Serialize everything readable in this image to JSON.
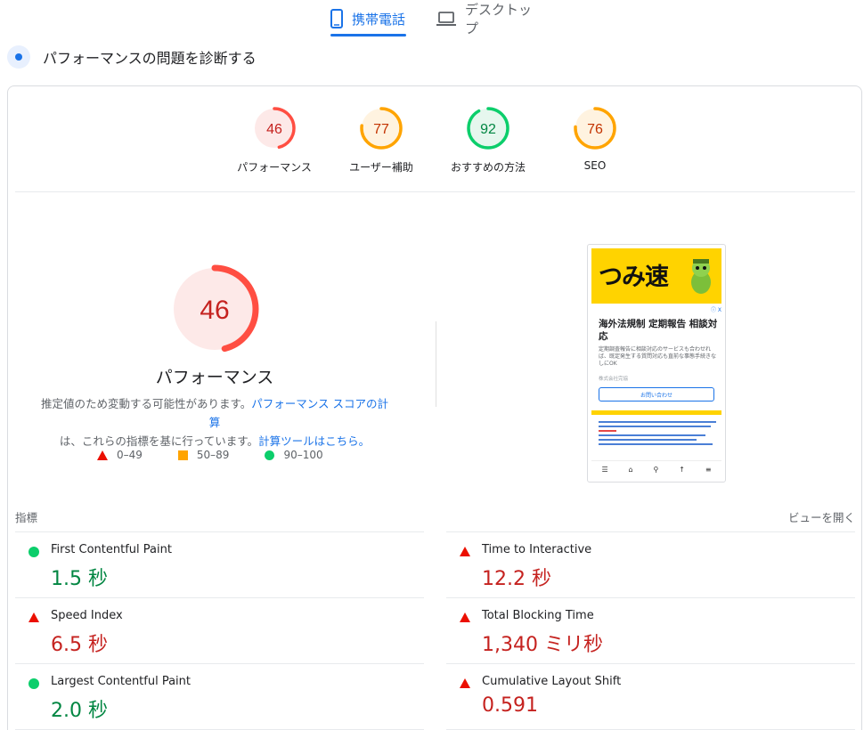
{
  "tabs": {
    "mobile_label": "携帯電話",
    "desktop_label": "デスクトップ"
  },
  "diagnose": {
    "title": "パフォーマンスの問題を診断する"
  },
  "colors": {
    "fail": "#ff4e42",
    "average": "#ffa400",
    "pass": "#0cce6b",
    "accent": "#1a73e8"
  },
  "scores": [
    {
      "label": "パフォーマンス",
      "value": 46,
      "level": "fail"
    },
    {
      "label": "ユーザー補助",
      "value": 77,
      "level": "average"
    },
    {
      "label": "おすすめの方法",
      "value": 92,
      "level": "pass"
    },
    {
      "label": "SEO",
      "value": 76,
      "level": "average"
    }
  ],
  "performance": {
    "score": "46",
    "title": "パフォーマンス",
    "desc_part1": "推定値のため変動する可能性があります。",
    "desc_link1": "パフォーマンス スコアの計算",
    "desc_part2": "は、これらの指標を基に行っています。",
    "desc_link2": "計算ツールはこちら。"
  },
  "legend": {
    "fail": "0–49",
    "average": "50–89",
    "pass": "90–100"
  },
  "screenshot": {
    "logo": "つみ速",
    "ad_tag": "ⓘ X",
    "ad_title": "海外法規制 定期報告 相談対応",
    "ad_text": "定期調査報告に相談対応のサービスも合わせれば、既定発生する質問対応も直前な事態手続きなしにOK",
    "company": "株式会社完協",
    "button": "お問い合わせ"
  },
  "metrics_header": {
    "left": "指標",
    "right": "ビューを開く"
  },
  "metrics": {
    "fcp": {
      "name": "First Contentful Paint",
      "value": "1.5 秒",
      "level": "pass"
    },
    "tti": {
      "name": "Time to Interactive",
      "value": "12.2 秒",
      "level": "fail"
    },
    "si": {
      "name": "Speed Index",
      "value": "6.5 秒",
      "level": "fail"
    },
    "tbt": {
      "name": "Total Blocking Time",
      "value": "1,340 ミリ秒",
      "level": "fail"
    },
    "lcp": {
      "name": "Largest Contentful Paint",
      "value": "2.0 秒",
      "level": "pass"
    },
    "cls": {
      "name": "Cumulative Layout Shift",
      "value": "0.591",
      "level": "fail"
    }
  }
}
